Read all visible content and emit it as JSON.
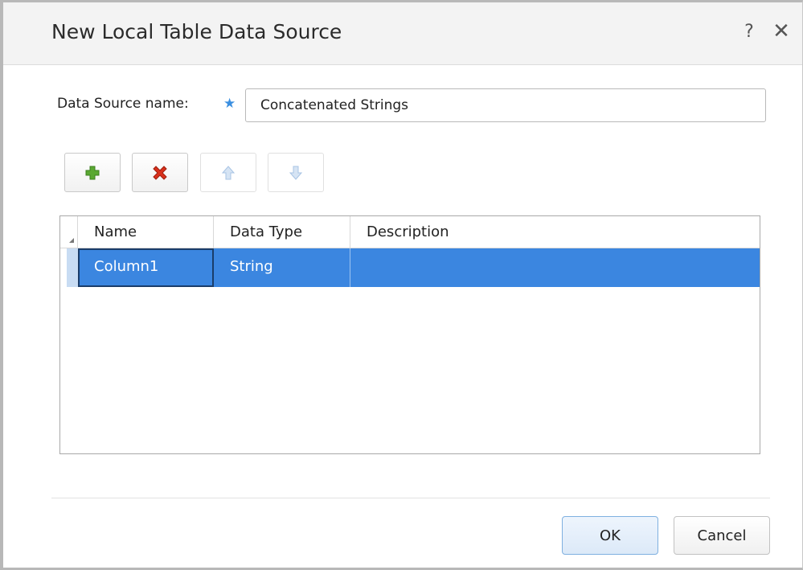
{
  "window": {
    "title": "New Local Table Data Source",
    "help_label": "?",
    "close_label": "✕"
  },
  "form": {
    "name_label": "Data Source name:",
    "required_marker": "★",
    "name_value": "Concatenated Strings"
  },
  "toolbar": {
    "buttons": [
      {
        "icon": "add-icon",
        "enabled": true
      },
      {
        "icon": "delete-icon",
        "enabled": true
      },
      {
        "icon": "move-up-icon",
        "enabled": false
      },
      {
        "icon": "move-down-icon",
        "enabled": false
      }
    ]
  },
  "grid": {
    "columns": [
      "Name",
      "Data Type",
      "Description"
    ],
    "rows": [
      {
        "name": "Column1",
        "data_type": "String",
        "description": "",
        "selected": true
      }
    ]
  },
  "footer": {
    "ok_label": "OK",
    "cancel_label": "Cancel"
  },
  "colors": {
    "selection": "#3b86e0",
    "add_icon": "#5aa832",
    "delete_icon": "#d9301c",
    "disabled_arrow": "#a8c4e4"
  }
}
